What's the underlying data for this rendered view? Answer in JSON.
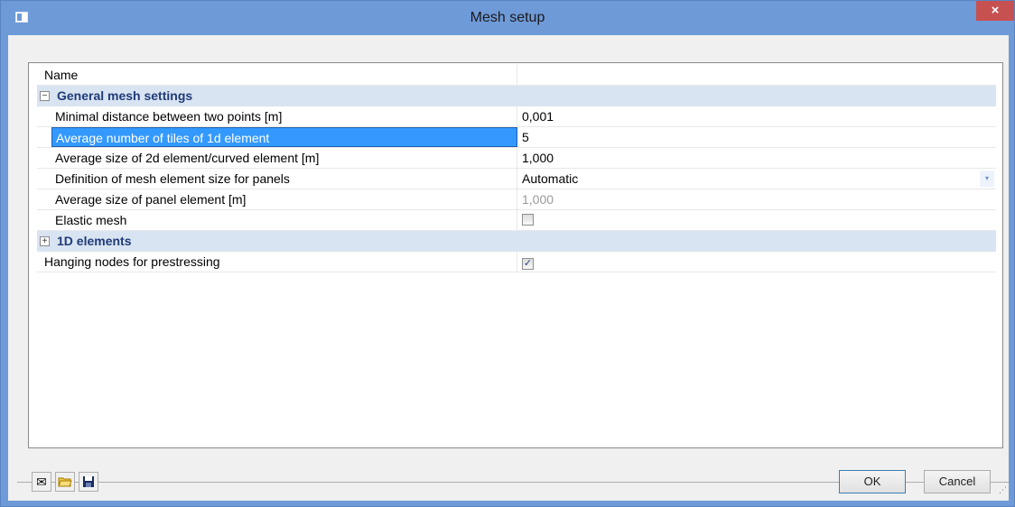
{
  "window": {
    "title": "Mesh setup",
    "close_glyph": "×"
  },
  "grid": {
    "name_label": "Name",
    "name_value": "",
    "general_group": {
      "label": "General mesh settings",
      "expander": "−",
      "rows": [
        {
          "label": "Minimal distance between two points [m]",
          "value": "0,001"
        },
        {
          "label": "Average number of tiles of 1d element",
          "value": "5",
          "selected": true
        },
        {
          "label": "Average size of 2d element/curved element [m]",
          "value": "1,000"
        },
        {
          "label": "Definition of mesh element size for panels",
          "value": "Automatic",
          "dropdown": true
        },
        {
          "label": "Average size of panel element [m]",
          "value": "1,000",
          "disabled": true
        },
        {
          "label": "Elastic mesh",
          "checked": false
        }
      ]
    },
    "elements_group": {
      "label": "1D elements",
      "expander": "+"
    },
    "hanging_nodes": {
      "label": "Hanging nodes for prestressing",
      "checked": true,
      "check_glyph": "✓"
    },
    "dropdown_glyph": "▾"
  },
  "toolbar": {
    "icons": [
      "new-file-icon",
      "open-folder-icon",
      "save-disk-icon"
    ],
    "new_glyph": "✉",
    "open_glyph": "📂",
    "save_glyph": "💾"
  },
  "buttons": {
    "ok_label": "OK",
    "cancel_label": "Cancel"
  },
  "resize_grip": "⋰"
}
